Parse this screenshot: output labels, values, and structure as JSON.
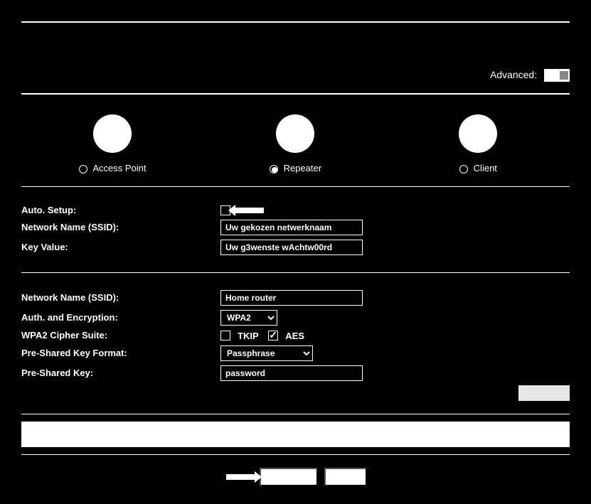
{
  "topbar": {
    "advanced_label": "Advanced:"
  },
  "modes": {
    "access_point": "Access Point",
    "repeater": "Repeater",
    "client": "Client",
    "selected": "repeater"
  },
  "section1": {
    "auto_setup_label": "Auto. Setup:",
    "auto_setup_checked": false,
    "ssid_label": "Network Name (SSID):",
    "ssid_value": "Uw gekozen netwerknaam",
    "key_label": "Key Value:",
    "key_value": "Uw g3wenste wAchtw00rd"
  },
  "section2": {
    "ssid_label": "Network Name (SSID):",
    "ssid_value": "Home router",
    "auth_label": "Auth. and Encryption:",
    "auth_value": "WPA2",
    "cipher_label": "WPA2 Cipher Suite:",
    "cipher_tkip": "TKIP",
    "cipher_tkip_checked": false,
    "cipher_aes": "AES",
    "cipher_aes_checked": true,
    "psk_format_label": "Pre-Shared Key Format:",
    "psk_format_value": "Passphrase",
    "psk_label": "Pre-Shared Key:",
    "psk_value": "password"
  },
  "buttons": {
    "apply": "",
    "previous": "",
    "reboot": ""
  }
}
